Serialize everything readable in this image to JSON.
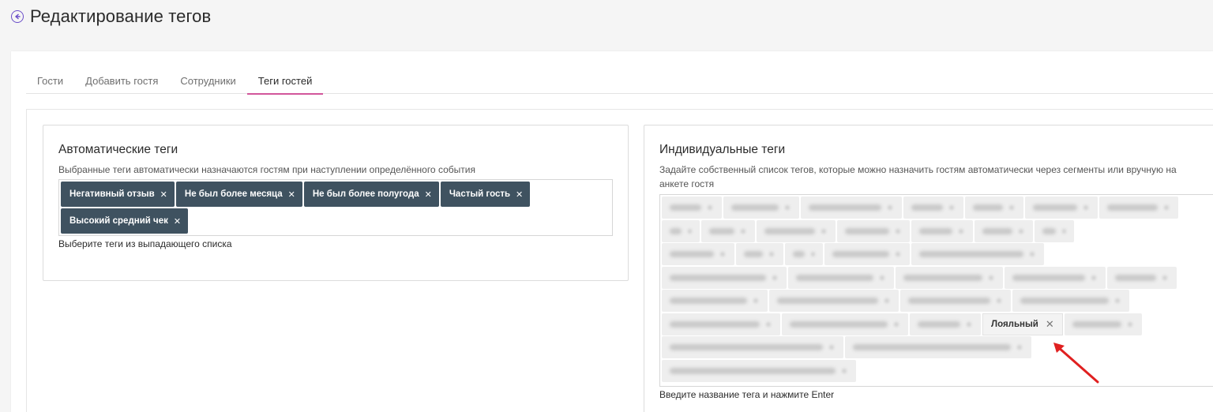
{
  "header": {
    "title": "Редактирование тегов"
  },
  "tabs": [
    {
      "label": "Гости",
      "active": false
    },
    {
      "label": "Добавить гостя",
      "active": false
    },
    {
      "label": "Сотрудники",
      "active": false
    },
    {
      "label": "Теги гостей",
      "active": true
    }
  ],
  "auto_tags": {
    "title": "Автоматические теги",
    "description": "Выбранные теги автоматически назначаются гостям при наступлении определённого события",
    "tags": [
      "Негативный отзыв",
      "Не был более месяца",
      "Не был более полугода",
      "Частый гость",
      "Высокий средний чек"
    ],
    "hint": "Выберите теги из выпадающего списка"
  },
  "individual_tags": {
    "title": "Индивидуальные теги",
    "description": "Задайте собственный список тегов, которые можно назначить гостям автоматически через сегменты или вручную на анкете гостя",
    "visible_tag": "Лояльный",
    "hint": "Введите название тега и нажмите Enter"
  },
  "colors": {
    "accent": "#d2569b",
    "tag_bg": "#3f5260",
    "back_icon": "#6b4ec9",
    "arrow": "#e02020"
  },
  "icons": {
    "back": "back-arrow-icon",
    "remove": "close-icon"
  }
}
